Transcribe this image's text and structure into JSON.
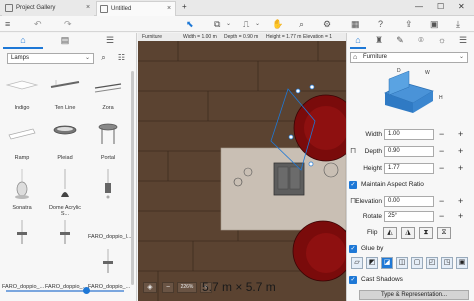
{
  "titlebar": {
    "tabs": [
      {
        "label": "Project Gallery"
      },
      {
        "label": "Untitled"
      }
    ],
    "new_tab": "+",
    "min": "—",
    "max": "☐",
    "close": "✕"
  },
  "left_panel": {
    "category": "Lamps",
    "items": [
      {
        "label": "Indigo"
      },
      {
        "label": "Ten Line"
      },
      {
        "label": "Zora"
      },
      {
        "label": "Ramp"
      },
      {
        "label": "Pleiad"
      },
      {
        "label": "Portal"
      },
      {
        "label": "Sonatra"
      },
      {
        "label": "Dome Acrylic S..."
      },
      {
        "label": "FARO_doppio_l..."
      },
      {
        "label": "FARO_doppio_..."
      },
      {
        "label": "FARO_doppio_..."
      },
      {
        "label": "FARO_doppio_..."
      }
    ],
    "zoom_level": 0.68
  },
  "canvas": {
    "info": {
      "category": "Furniture",
      "width": "Width = 1.00 m",
      "depth": "Depth = 0.90 m",
      "height": "Height = 1.77 m",
      "elevation": "Elevation = 1"
    },
    "zoom": "226%",
    "minus": "−",
    "plus": "+",
    "dimensions": "5.7 m × 5.7 m",
    "wood_color": "#5b4331",
    "rug_color": "#c9bfb4",
    "chair_color": "#7a0b0b"
  },
  "right_panel": {
    "type": "Furniture",
    "dim_labels": {
      "d": "D",
      "w": "W",
      "h": "H"
    },
    "props": [
      {
        "label": "Width",
        "value": "1.00"
      },
      {
        "label": "Depth",
        "value": "0.90"
      },
      {
        "label": "Height",
        "value": "1.77"
      }
    ],
    "maintain_aspect": "Maintain Aspect Ratio",
    "elevation": {
      "label": "Elevation",
      "value": "0.00"
    },
    "rotate": {
      "label": "Rotate",
      "value": "25°"
    },
    "flip": "Flip",
    "glue_by": "Glue by",
    "cast_shadows": "Cast Shadows",
    "type_button": "Type & Representation...",
    "accent": "#1e78d6"
  }
}
